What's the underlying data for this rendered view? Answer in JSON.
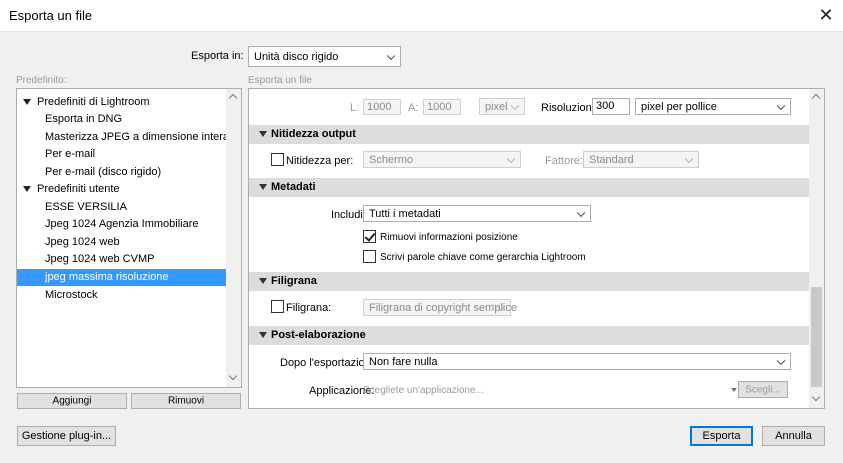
{
  "window": {
    "title": "Esporta un file"
  },
  "export_in": {
    "label": "Esporta in:",
    "value": "Unità disco rigido"
  },
  "presets": {
    "label": "Predefinito:",
    "groups": [
      {
        "name": "Predefiniti di Lightroom",
        "items": [
          "Esporta in DNG",
          "Masterizza JPEG a dimensione intera",
          "Per e-mail",
          "Per e-mail (disco rigido)"
        ]
      },
      {
        "name": "Predefiniti utente",
        "items": [
          "ESSE VERSILIA",
          "Jpeg 1024 Agenzia Immobiliare",
          "Jpeg 1024 web",
          "Jpeg 1024 web CVMP",
          "jpeg massima risoluzione"
        ]
      }
    ],
    "extra_items": [
      "Microstock"
    ],
    "selected": "jpeg massima risoluzione",
    "add_button": "Aggiungi",
    "remove_button": "Rimuovi"
  },
  "export_panel": {
    "label": "Esporta un file",
    "size_row": {
      "l_label": "L:",
      "l_value": "1000",
      "a_label": "A:",
      "a_value": "1000",
      "unit": "pixel",
      "resolution_label": "Risoluzione:",
      "resolution_value": "300",
      "resolution_unit": "pixel per pollice"
    },
    "sharpening": {
      "title": "Nitidezza output",
      "checkbox_label": "Nitidezza per:",
      "target": "Schermo",
      "amount_label": "Fattore:",
      "amount": "Standard"
    },
    "metadata": {
      "title": "Metadati",
      "include_label": "Includi:",
      "include_value": "Tutti i metadati",
      "remove_location": "Rimuovi informazioni posizione",
      "keywords_hierarchy": "Scrivi parole chiave come gerarchia Lightroom"
    },
    "watermark": {
      "title": "Filigrana",
      "checkbox_label": "Filigrana:",
      "value": "Filigrana di copyright semplice"
    },
    "post_processing": {
      "title": "Post-elaborazione",
      "after_label": "Dopo l'esportazione:",
      "after_value": "Non fare nulla",
      "app_label": "Applicazione:",
      "app_placeholder": "Scegliete un'applicazione...",
      "choose_button": "Scegli..."
    }
  },
  "footer": {
    "plugin_button": "Gestione plug-in...",
    "export_button": "Esporta",
    "cancel_button": "Annulla"
  }
}
